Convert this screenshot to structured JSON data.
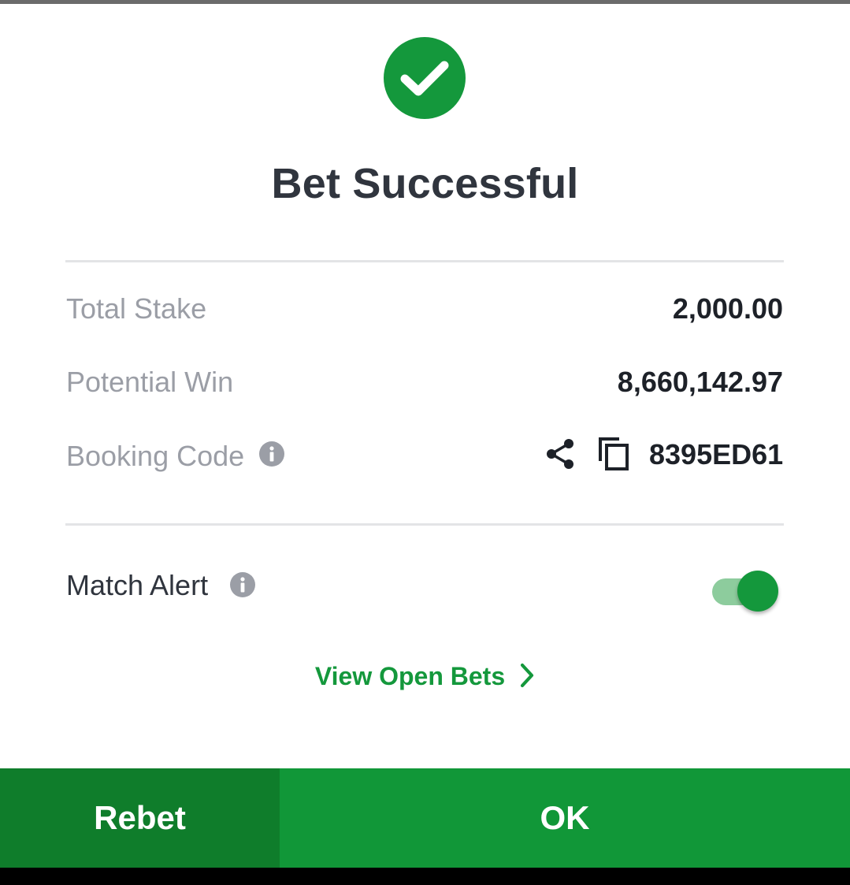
{
  "status": {
    "icon": "check-circle-icon",
    "title": "Bet Successful"
  },
  "summary": {
    "total_stake_label": "Total Stake",
    "total_stake_value": "2,000.00",
    "potential_win_label": "Potential Win",
    "potential_win_value": "8,660,142.97",
    "booking_code_label": "Booking Code",
    "booking_code_value": "8395ED61"
  },
  "match_alert": {
    "label": "Match Alert",
    "enabled": true
  },
  "links": {
    "view_open_bets": "View Open Bets"
  },
  "buttons": {
    "rebet": "Rebet",
    "ok": "OK"
  },
  "colors": {
    "brand_green": "#14983c",
    "rebet_green": "#0f7d2b",
    "ok_green": "#119738"
  }
}
